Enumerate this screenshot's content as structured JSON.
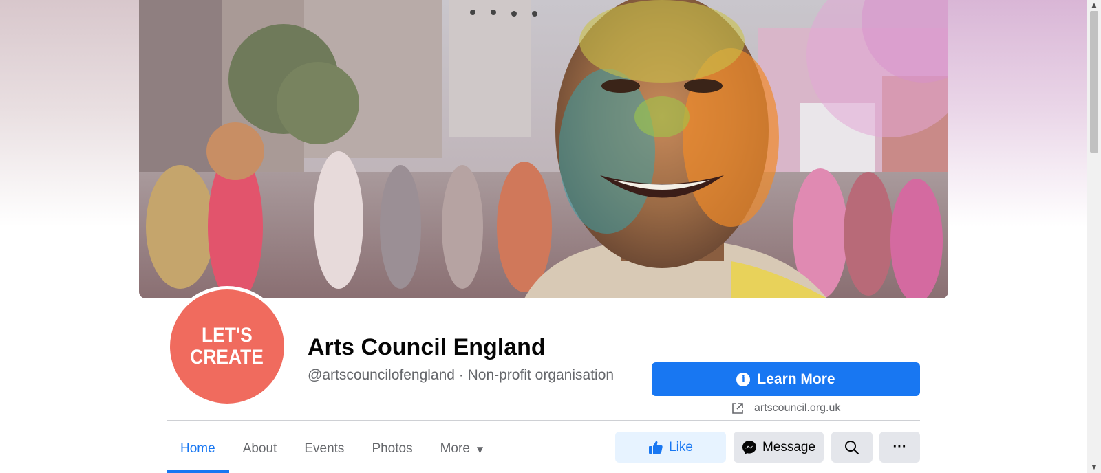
{
  "page": {
    "name": "Arts Council England",
    "subtitle": "@artscouncilofengland · Non-profit organisation",
    "avatar": {
      "line1": "LET'S",
      "line2": "CREATE",
      "color": "#f06b5e"
    }
  },
  "cta": {
    "learn_more_label": "Learn More",
    "info_icon_glyph": "i",
    "website": "artscouncil.org.uk"
  },
  "tabs": [
    {
      "label": "Home",
      "active": true
    },
    {
      "label": "About",
      "active": false
    },
    {
      "label": "Events",
      "active": false
    },
    {
      "label": "Photos",
      "active": false
    },
    {
      "label": "More",
      "active": false
    }
  ],
  "actions": {
    "like_label": "Like",
    "message_label": "Message",
    "search_icon": "search-icon",
    "more_glyph": "···"
  },
  "colors": {
    "accent": "#1877f2",
    "button_gray": "#e4e6eb",
    "like_bg": "#e7f3ff",
    "muted_text": "#65676b"
  },
  "scrollbar": {
    "up_glyph": "▲",
    "down_glyph": "▼"
  }
}
